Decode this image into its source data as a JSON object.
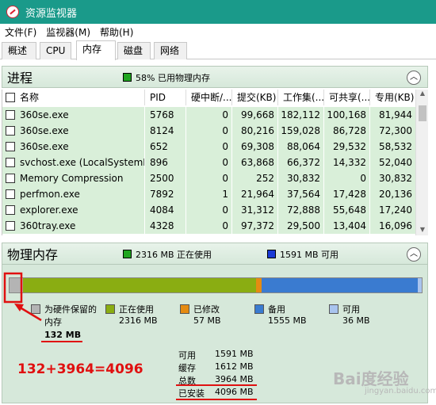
{
  "window": {
    "title": "资源监视器"
  },
  "menu": [
    "文件(F)",
    "监视器(M)",
    "帮助(H)"
  ],
  "tabs": [
    "概述",
    "CPU",
    "内存",
    "磁盘",
    "网络"
  ],
  "process_section": {
    "title": "进程",
    "usage_label": "58% 已用物理内存",
    "columns": [
      "名称",
      "PID",
      "硬中断/...",
      "提交(KB)",
      "工作集(...",
      "可共享(...",
      "专用(KB)"
    ],
    "rows": [
      [
        "360se.exe",
        "5768",
        "0",
        "99,668",
        "182,112",
        "100,168",
        "81,944"
      ],
      [
        "360se.exe",
        "8124",
        "0",
        "80,216",
        "159,028",
        "86,728",
        "72,300"
      ],
      [
        "360se.exe",
        "652",
        "0",
        "69,308",
        "88,064",
        "29,532",
        "58,532"
      ],
      [
        "svchost.exe (LocalSystemN...",
        "896",
        "0",
        "63,868",
        "66,372",
        "14,332",
        "52,040"
      ],
      [
        "Memory Compression",
        "2500",
        "0",
        "252",
        "30,832",
        "0",
        "30,832"
      ],
      [
        "perfmon.exe",
        "7892",
        "1",
        "21,964",
        "37,564",
        "17,428",
        "20,136"
      ],
      [
        "explorer.exe",
        "4084",
        "0",
        "31,312",
        "72,888",
        "55,648",
        "17,240"
      ],
      [
        "360tray.exe",
        "4328",
        "0",
        "97,372",
        "29,500",
        "13,404",
        "16,096"
      ]
    ]
  },
  "memory_section": {
    "title": "物理内存",
    "in_use_label": "2316 MB 正在使用",
    "available_label": "1591 MB 可用",
    "bar_mb": {
      "reserved": 132,
      "in_use": 2316,
      "modified": 57,
      "standby": 1555,
      "free": 36
    },
    "legend": [
      {
        "label": "为硬件保留的",
        "label2": "内存",
        "value": "132 MB",
        "color": "#b4b4b4"
      },
      {
        "label": "正在使用",
        "value": "2316 MB",
        "color": "#8aad12"
      },
      {
        "label": "已修改",
        "value": "57 MB",
        "color": "#e58b12"
      },
      {
        "label": "备用",
        "value": "1555 MB",
        "color": "#3a7bd0"
      },
      {
        "label": "可用",
        "value": "36 MB",
        "color": "#a9c4ee"
      }
    ],
    "stats": [
      {
        "key": "可用",
        "value": "1591 MB"
      },
      {
        "key": "缓存",
        "value": "1612 MB"
      },
      {
        "key": "总数",
        "value": "3964 MB"
      },
      {
        "key": "已安装",
        "value": "4096 MB"
      }
    ]
  },
  "annotation": {
    "equation": "132+3964=4096",
    "color": "#e01010"
  },
  "watermark": {
    "text": "Bai度经验",
    "sub": "jingyan.baidu.com"
  }
}
